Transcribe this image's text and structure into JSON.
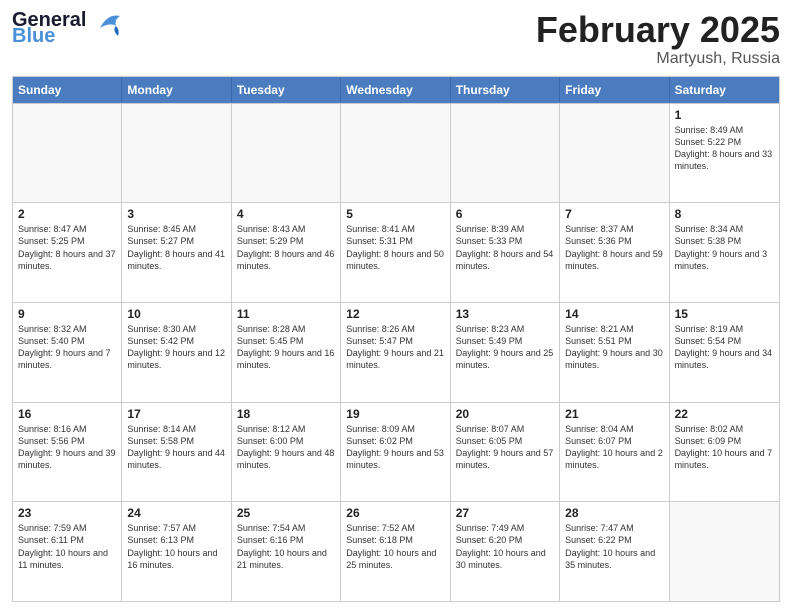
{
  "header": {
    "logo_line1_dark": "General",
    "logo_line2_blue": "Blue",
    "month_title": "February 2025",
    "subtitle": "Martyush, Russia"
  },
  "days_of_week": [
    "Sunday",
    "Monday",
    "Tuesday",
    "Wednesday",
    "Thursday",
    "Friday",
    "Saturday"
  ],
  "weeks": [
    [
      {
        "day": "",
        "info": ""
      },
      {
        "day": "",
        "info": ""
      },
      {
        "day": "",
        "info": ""
      },
      {
        "day": "",
        "info": ""
      },
      {
        "day": "",
        "info": ""
      },
      {
        "day": "",
        "info": ""
      },
      {
        "day": "1",
        "info": "Sunrise: 8:49 AM\nSunset: 5:22 PM\nDaylight: 8 hours and 33 minutes."
      }
    ],
    [
      {
        "day": "2",
        "info": "Sunrise: 8:47 AM\nSunset: 5:25 PM\nDaylight: 8 hours and 37 minutes."
      },
      {
        "day": "3",
        "info": "Sunrise: 8:45 AM\nSunset: 5:27 PM\nDaylight: 8 hours and 41 minutes."
      },
      {
        "day": "4",
        "info": "Sunrise: 8:43 AM\nSunset: 5:29 PM\nDaylight: 8 hours and 46 minutes."
      },
      {
        "day": "5",
        "info": "Sunrise: 8:41 AM\nSunset: 5:31 PM\nDaylight: 8 hours and 50 minutes."
      },
      {
        "day": "6",
        "info": "Sunrise: 8:39 AM\nSunset: 5:33 PM\nDaylight: 8 hours and 54 minutes."
      },
      {
        "day": "7",
        "info": "Sunrise: 8:37 AM\nSunset: 5:36 PM\nDaylight: 8 hours and 59 minutes."
      },
      {
        "day": "8",
        "info": "Sunrise: 8:34 AM\nSunset: 5:38 PM\nDaylight: 9 hours and 3 minutes."
      }
    ],
    [
      {
        "day": "9",
        "info": "Sunrise: 8:32 AM\nSunset: 5:40 PM\nDaylight: 9 hours and 7 minutes."
      },
      {
        "day": "10",
        "info": "Sunrise: 8:30 AM\nSunset: 5:42 PM\nDaylight: 9 hours and 12 minutes."
      },
      {
        "day": "11",
        "info": "Sunrise: 8:28 AM\nSunset: 5:45 PM\nDaylight: 9 hours and 16 minutes."
      },
      {
        "day": "12",
        "info": "Sunrise: 8:26 AM\nSunset: 5:47 PM\nDaylight: 9 hours and 21 minutes."
      },
      {
        "day": "13",
        "info": "Sunrise: 8:23 AM\nSunset: 5:49 PM\nDaylight: 9 hours and 25 minutes."
      },
      {
        "day": "14",
        "info": "Sunrise: 8:21 AM\nSunset: 5:51 PM\nDaylight: 9 hours and 30 minutes."
      },
      {
        "day": "15",
        "info": "Sunrise: 8:19 AM\nSunset: 5:54 PM\nDaylight: 9 hours and 34 minutes."
      }
    ],
    [
      {
        "day": "16",
        "info": "Sunrise: 8:16 AM\nSunset: 5:56 PM\nDaylight: 9 hours and 39 minutes."
      },
      {
        "day": "17",
        "info": "Sunrise: 8:14 AM\nSunset: 5:58 PM\nDaylight: 9 hours and 44 minutes."
      },
      {
        "day": "18",
        "info": "Sunrise: 8:12 AM\nSunset: 6:00 PM\nDaylight: 9 hours and 48 minutes."
      },
      {
        "day": "19",
        "info": "Sunrise: 8:09 AM\nSunset: 6:02 PM\nDaylight: 9 hours and 53 minutes."
      },
      {
        "day": "20",
        "info": "Sunrise: 8:07 AM\nSunset: 6:05 PM\nDaylight: 9 hours and 57 minutes."
      },
      {
        "day": "21",
        "info": "Sunrise: 8:04 AM\nSunset: 6:07 PM\nDaylight: 10 hours and 2 minutes."
      },
      {
        "day": "22",
        "info": "Sunrise: 8:02 AM\nSunset: 6:09 PM\nDaylight: 10 hours and 7 minutes."
      }
    ],
    [
      {
        "day": "23",
        "info": "Sunrise: 7:59 AM\nSunset: 6:11 PM\nDaylight: 10 hours and 11 minutes."
      },
      {
        "day": "24",
        "info": "Sunrise: 7:57 AM\nSunset: 6:13 PM\nDaylight: 10 hours and 16 minutes."
      },
      {
        "day": "25",
        "info": "Sunrise: 7:54 AM\nSunset: 6:16 PM\nDaylight: 10 hours and 21 minutes."
      },
      {
        "day": "26",
        "info": "Sunrise: 7:52 AM\nSunset: 6:18 PM\nDaylight: 10 hours and 25 minutes."
      },
      {
        "day": "27",
        "info": "Sunrise: 7:49 AM\nSunset: 6:20 PM\nDaylight: 10 hours and 30 minutes."
      },
      {
        "day": "28",
        "info": "Sunrise: 7:47 AM\nSunset: 6:22 PM\nDaylight: 10 hours and 35 minutes."
      },
      {
        "day": "",
        "info": ""
      }
    ]
  ]
}
